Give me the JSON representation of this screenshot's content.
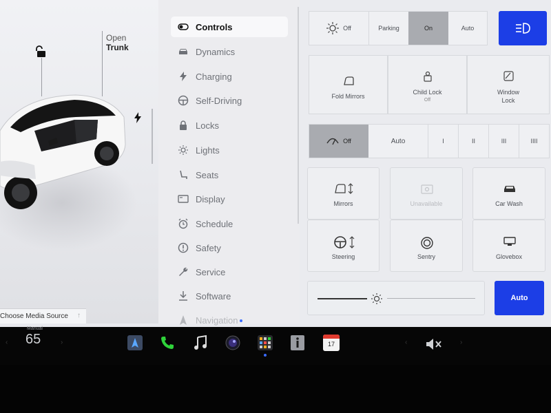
{
  "car_panel": {
    "trunk_label_line1": "Open",
    "trunk_label_line2": "Trunk",
    "media_source": "Choose Media Source"
  },
  "menu": {
    "items": [
      {
        "label": "Controls",
        "icon": "toggle-icon",
        "active": true
      },
      {
        "label": "Dynamics",
        "icon": "car-icon"
      },
      {
        "label": "Charging",
        "icon": "bolt-icon"
      },
      {
        "label": "Self-Driving",
        "icon": "steering-wheel-icon"
      },
      {
        "label": "Locks",
        "icon": "lock-icon"
      },
      {
        "label": "Lights",
        "icon": "sun-icon"
      },
      {
        "label": "Seats",
        "icon": "seat-icon"
      },
      {
        "label": "Display",
        "icon": "display-icon"
      },
      {
        "label": "Schedule",
        "icon": "alarm-clock-icon"
      },
      {
        "label": "Safety",
        "icon": "alert-circle-icon"
      },
      {
        "label": "Service",
        "icon": "wrench-icon"
      },
      {
        "label": "Software",
        "icon": "download-icon"
      },
      {
        "label": "Navigation",
        "icon": "navigation-icon"
      }
    ]
  },
  "lights": {
    "options": [
      "Off",
      "Parking",
      "On",
      "Auto"
    ],
    "selected": "On"
  },
  "mirror_row": {
    "fold_mirrors": "Fold Mirrors",
    "child_lock": "Child Lock",
    "child_lock_state": "Off",
    "window_lock_line1": "Window",
    "window_lock_line2": "Lock"
  },
  "wipers": {
    "options": [
      "Off",
      "Auto",
      "I",
      "II",
      "III",
      "IIII"
    ],
    "selected": "Off"
  },
  "grid": {
    "mirrors": "Mirrors",
    "unavailable": "Unavailable",
    "car_wash": "Car Wash",
    "steering": "Steering",
    "sentry": "Sentry",
    "glovebox": "Glovebox"
  },
  "brightness": {
    "auto_label": "Auto",
    "level": 0.43
  },
  "taskbar": {
    "temp_mode": "Manual",
    "temperature": "65",
    "calendar_day": "17"
  },
  "colors": {
    "accent_blue": "#1c3ee6",
    "selected_gray": "#a9abb0",
    "screen_bg": "#eaebef"
  }
}
